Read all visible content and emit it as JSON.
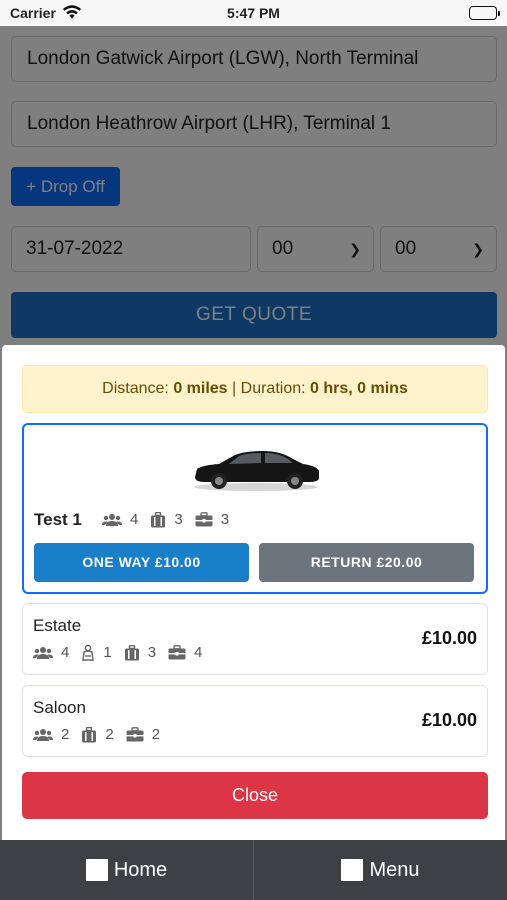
{
  "status_bar": {
    "carrier": "Carrier",
    "time": "5:47 PM"
  },
  "form": {
    "pickup": "London Gatwick Airport (LGW), North Terminal",
    "dropoff": "London Heathrow Airport (LHR), Terminal 1",
    "add_dropoff_label": "+ Drop Off",
    "date": "31-07-2022",
    "hour": "00",
    "minute": "00",
    "get_quote_label": "GET QUOTE"
  },
  "modal": {
    "info": {
      "distance_label": "Distance:",
      "distance_value": "0 miles",
      "separator": "|",
      "duration_label": "Duration:",
      "duration_value": "0 hrs, 0 mins"
    },
    "selected_vehicle": {
      "name": "Test 1",
      "passengers": "4",
      "luggage": "3",
      "bags": "3",
      "one_way_label": "ONE WAY £10.00",
      "return_label": "RETURN £20.00"
    },
    "vehicles": [
      {
        "name": "Estate",
        "passengers": "4",
        "child_seats": "1",
        "luggage": "3",
        "bags": "4",
        "price": "£10.00"
      },
      {
        "name": "Saloon",
        "passengers": "2",
        "luggage": "2",
        "bags": "2",
        "price": "£10.00"
      }
    ],
    "close_label": "Close"
  },
  "tab_bar": {
    "home_label": "Home",
    "menu_label": "Menu"
  },
  "colors": {
    "primary": "#0d6efd",
    "danger": "#dc3545",
    "secondary": "#6c757d",
    "warning_bg": "#fff3cd"
  }
}
